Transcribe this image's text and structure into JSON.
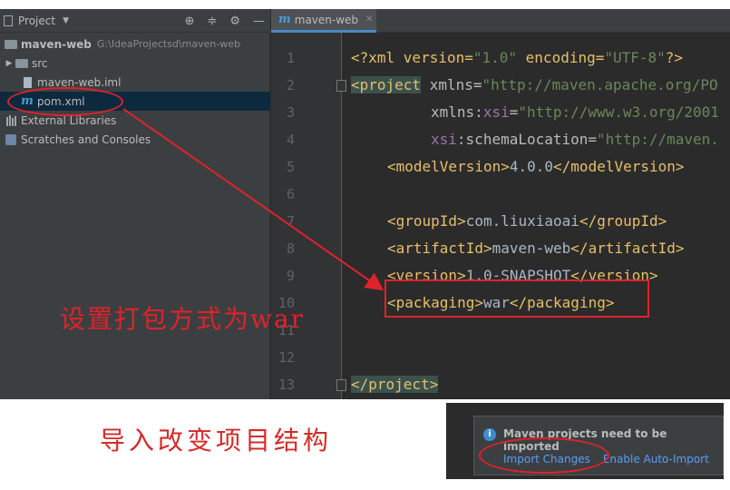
{
  "project_panel": {
    "title": "Project",
    "tree": {
      "root_name": "maven-web",
      "root_path": "G:\\IdeaProjectsd\\maven-web",
      "src": "src",
      "iml": "maven-web.iml",
      "pom": "pom.xml",
      "external_libraries": "External Libraries",
      "scratches": "Scratches and Consoles"
    }
  },
  "editor": {
    "tab_label": "maven-web",
    "line_numbers": [
      "1",
      "2",
      "3",
      "4",
      "5",
      "6",
      "7",
      "8",
      "9",
      "10",
      "11",
      "12",
      "13"
    ],
    "lines": {
      "l1": {
        "open": "<?xml version=",
        "v1": "\"1.0\"",
        "mid": " encoding=",
        "v2": "\"UTF-8\"",
        "close": "?>"
      },
      "l2": {
        "tag": "<project",
        "attr": " xmlns=",
        "val": "\"http://maven.apache.org/PO"
      },
      "l3": {
        "ns": "xmlns",
        "colon": ":",
        "attr": "xsi",
        "eq": "=",
        "val": "\"http://www.w3.org/2001"
      },
      "l4": {
        "ns": "xsi",
        "colon": ":",
        "attr": "schemaLocation",
        "eq": "=",
        "val": "\"http://maven."
      },
      "l5": {
        "o": "<modelVersion>",
        "t": "4.0.0",
        "c": "</modelVersion>"
      },
      "l7": {
        "o": "<groupId>",
        "t": "com.liuxiaoai",
        "c": "</groupId>"
      },
      "l8": {
        "o": "<artifactId>",
        "t": "maven-web",
        "c": "</artifactId>"
      },
      "l9": {
        "o": "<version>",
        "t": "1.0-SNAPSHOT",
        "c": "</version>"
      },
      "l10": {
        "o": "<packaging>",
        "t": "war",
        "c": "</packaging>"
      },
      "l13": {
        "c": "</project>"
      }
    }
  },
  "annotations": {
    "packaging_note": "设置打包方式为war",
    "import_note": "导入改变项目结构"
  },
  "notification": {
    "message": "Maven projects need to be imported",
    "link_import": "Import Changes",
    "link_auto": "Enable Auto-Import"
  },
  "colors": {
    "annotation_red": "#e0222a",
    "xml_tag": "#e8bf6a",
    "xml_string": "#6a8759",
    "link_blue": "#589df6"
  }
}
